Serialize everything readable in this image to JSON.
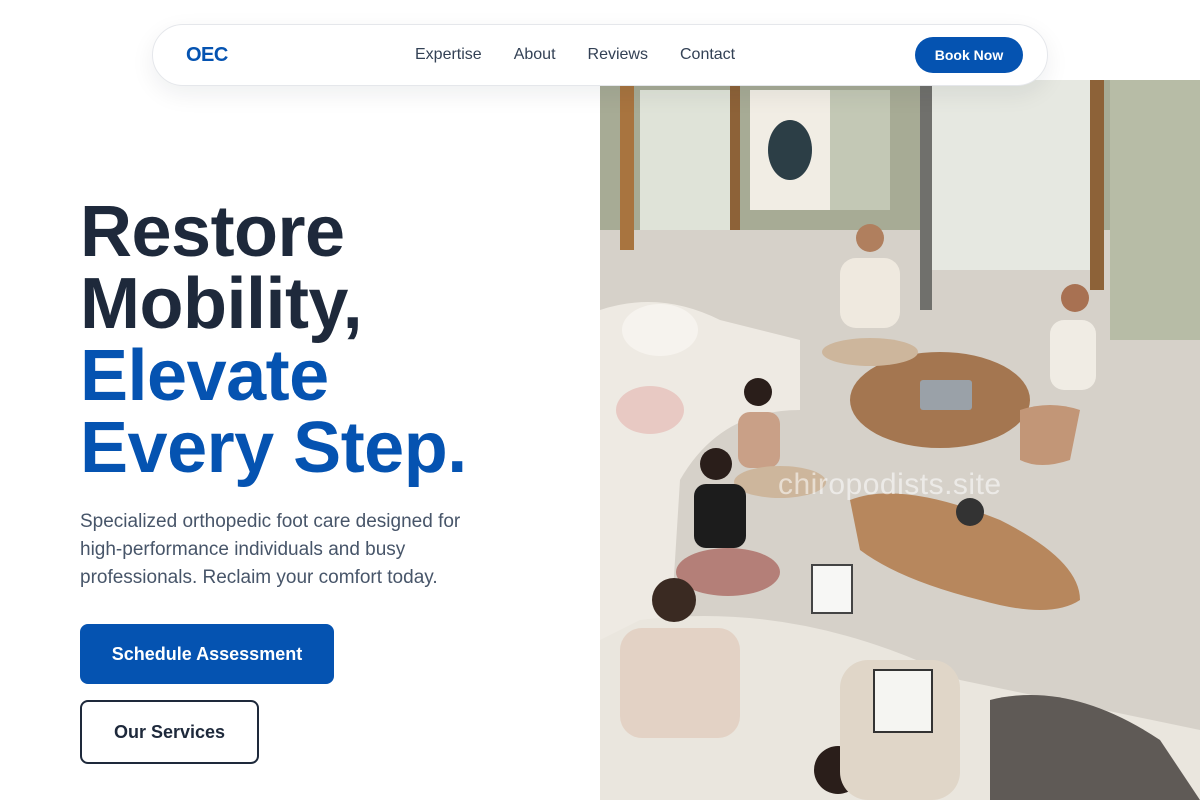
{
  "nav": {
    "logo": "OEC",
    "links": [
      "Expertise",
      "About",
      "Reviews",
      "Contact"
    ],
    "cta": "Book Now"
  },
  "hero": {
    "title_line1": "Restore",
    "title_line2": "Mobility,",
    "title_line3": "Elevate",
    "title_line4": "Every Step.",
    "description": "Specialized orthopedic foot care designed for high-performance individuals and busy professionals. Reclaim your comfort today.",
    "primary_cta": "Schedule Assessment",
    "secondary_cta": "Our Services"
  },
  "image": {
    "alt": "People sitting cross-legged in a bright room with laptops and tea",
    "watermark": "chiropodists.site"
  },
  "colors": {
    "brand": "#0553b1",
    "heading": "#1e293b",
    "body_text": "#475569"
  }
}
